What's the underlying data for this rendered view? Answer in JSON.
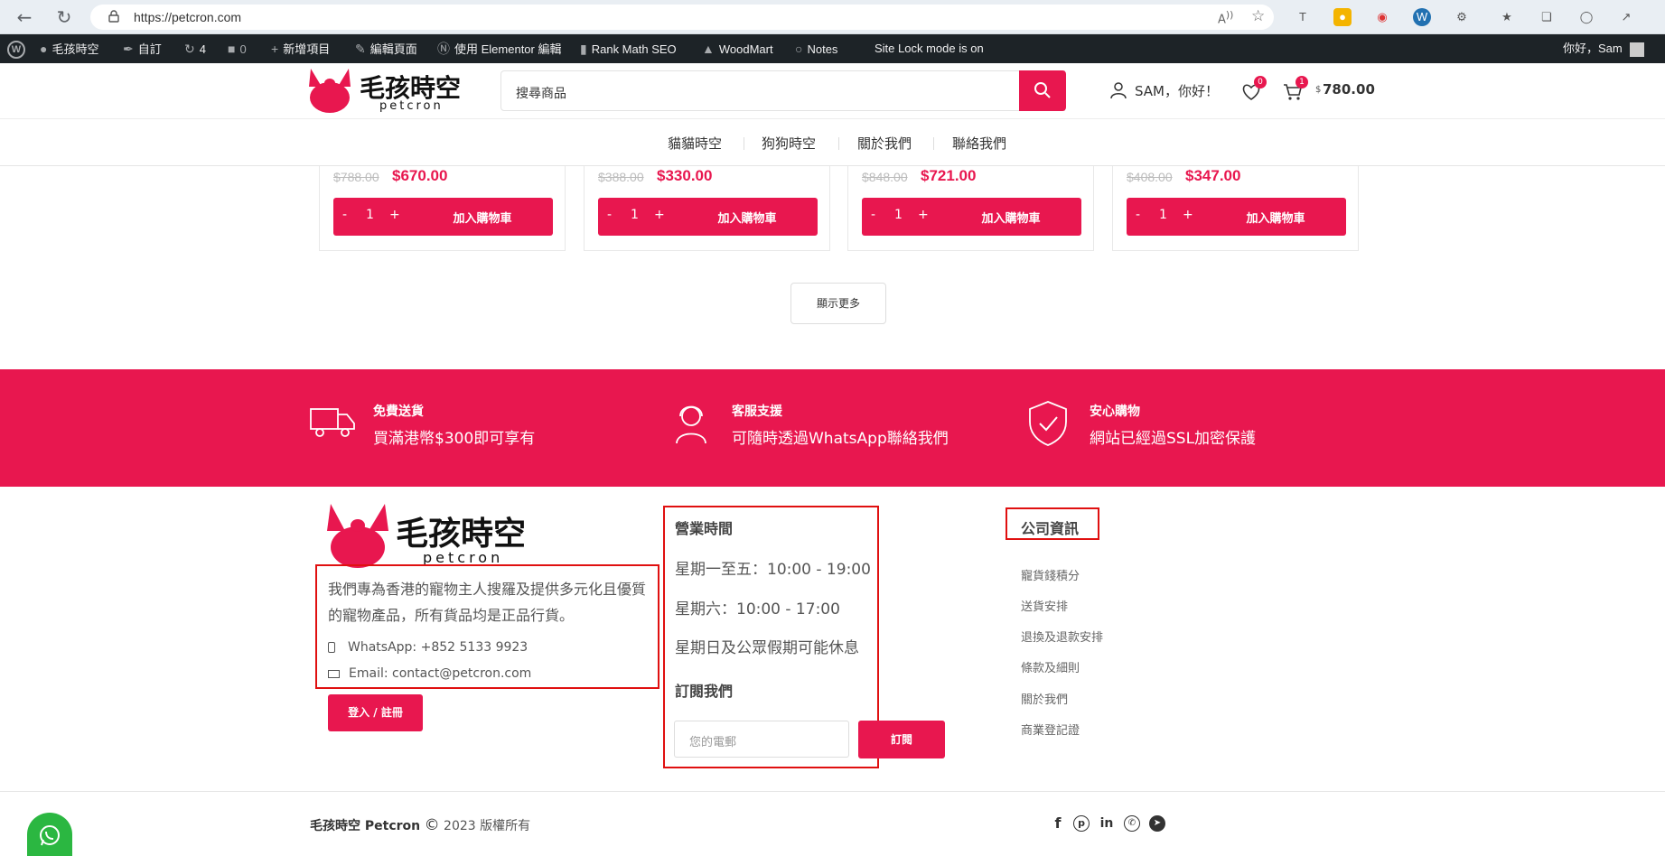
{
  "browser": {
    "url": "https://petcron.com",
    "icons": [
      "back-icon",
      "refresh-icon",
      "lock-icon",
      "read-aloud-icon",
      "favorite-icon"
    ]
  },
  "admin_bar": {
    "site_name": "毛孩時空",
    "customize": "自訂",
    "updates": "4",
    "comments": "0",
    "new_item": "新增項目",
    "edit_page": "編輯頁面",
    "elementor": "使用 Elementor 編輯",
    "rank_math": "Rank Math SEO",
    "woodmart": "WoodMart",
    "notes": "Notes",
    "site_lock": "Site Lock mode is on",
    "greeting": "你好，Sam"
  },
  "header": {
    "logo_text": "毛孩時空",
    "logo_sub": "petcron",
    "search_placeholder": "搜尋商品",
    "account": "SAM，你好！",
    "wishlist_count": "0",
    "cart_count": "1",
    "cart_currency": "$",
    "cart_total": "780.00"
  },
  "nav": {
    "items": [
      "貓貓時空",
      "狗狗時空",
      "關於我們",
      "聯絡我們"
    ]
  },
  "products": [
    {
      "old_price": "$788.00",
      "new_price": "$670.00",
      "qty": "1"
    },
    {
      "old_price": "$388.00",
      "new_price": "$330.00",
      "qty": "1"
    },
    {
      "old_price": "$848.00",
      "new_price": "$721.00",
      "qty": "1"
    },
    {
      "old_price": "$408.00",
      "new_price": "$347.00",
      "qty": "1"
    }
  ],
  "product_ui": {
    "minus": "-",
    "plus": "+",
    "add_to_cart": "加入購物車"
  },
  "show_more": "顯示更多",
  "features": [
    {
      "title": "免費送貨",
      "desc": "買滿港幣$300即可享有",
      "icon": "truck-icon"
    },
    {
      "title": "客服支援",
      "desc": "可隨時透過WhatsApp聯絡我們",
      "icon": "support-agent-icon"
    },
    {
      "title": "安心購物",
      "desc": "網站已經過SSL加密保護",
      "icon": "shield-check-icon"
    }
  ],
  "footer": {
    "logo_text": "毛孩時空",
    "logo_sub": "petcron",
    "about": "我們專為香港的寵物主人搜羅及提供多元化且優質的寵物產品，所有貨品均是正品行貨。",
    "whatsapp": "WhatsApp: +852 5133 9923",
    "email": "Email: contact@petcron.com",
    "login_button": "登入 / 註冊",
    "hours_title": "營業時間",
    "hours": [
      "星期一至五：10:00 - 19:00",
      "星期六：10:00 - 17:00",
      "星期日及公眾假期可能休息"
    ],
    "subscribe_title": "訂閱我們",
    "email_placeholder": "您的電郵",
    "subscribe_button": "訂閱",
    "company_title": "公司資訊",
    "company_links": [
      "寵貨錢積分",
      "送貨安排",
      "退換及退款安排",
      "條款及細則",
      "關於我們",
      "商業登記證"
    ]
  },
  "copyright": {
    "brand": "毛孩時空 Petcron",
    "symbol": "©",
    "text": "2023 版權所有"
  },
  "colors": {
    "accent": "#e8174f",
    "highlight_box": "#e01010",
    "admin_bar": "#1d2327"
  }
}
